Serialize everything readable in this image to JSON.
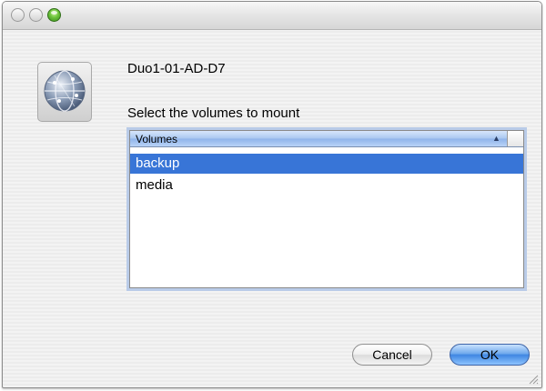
{
  "window": {
    "title": "",
    "controls": [
      {
        "name": "close",
        "icon": "close-icon"
      },
      {
        "name": "minimize",
        "icon": "minimize-icon"
      },
      {
        "name": "zoom",
        "icon": "zoom-icon",
        "color": "#5fbb35"
      }
    ]
  },
  "server": {
    "icon": "network-globe-icon",
    "name": "Duo1-01-AD-D7"
  },
  "prompt": "Select the volumes to mount",
  "volumes_table": {
    "column_header": "Volumes",
    "sort_indicator": "▲",
    "rows": [
      {
        "label": "backup",
        "selected": true
      },
      {
        "label": "media",
        "selected": false
      }
    ],
    "selection_color": "#3875d7"
  },
  "buttons": {
    "cancel_label": "Cancel",
    "ok_label": "OK",
    "default_button_color": "#3f86e2"
  }
}
